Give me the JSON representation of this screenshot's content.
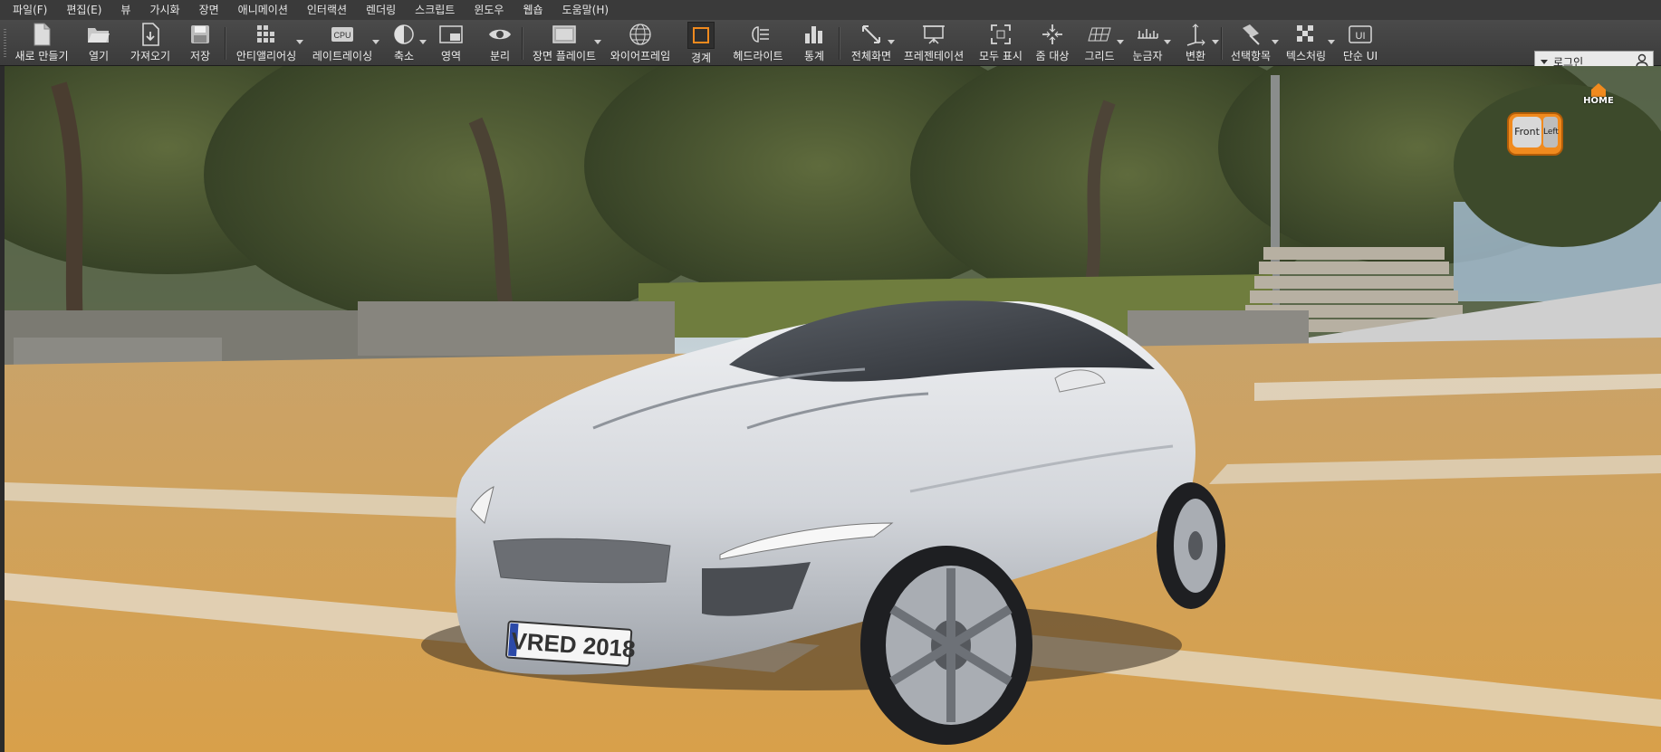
{
  "menu": [
    "파일(F)",
    "편집(E)",
    "뷰",
    "가시화",
    "장면",
    "애니메이션",
    "인터랙션",
    "렌더링",
    "스크립트",
    "윈도우",
    "웹숍",
    "도움말(H)"
  ],
  "toolbar": [
    {
      "label": "새로 만들기",
      "icon": "new-file-icon"
    },
    {
      "label": "열기",
      "icon": "open-folder-icon"
    },
    {
      "label": "가져오기",
      "icon": "import-icon"
    },
    {
      "label": "저장",
      "icon": "save-icon"
    },
    {
      "label": "안티앨리어싱",
      "icon": "antialiasing-icon"
    },
    {
      "label": "레이트레이싱",
      "icon": "cpu-icon"
    },
    {
      "label": "축소",
      "icon": "contrast-icon"
    },
    {
      "label": "영역",
      "icon": "region-icon"
    },
    {
      "label": "분리",
      "icon": "eye-icon"
    },
    {
      "label": "장면 플레이트",
      "icon": "scene-plate-icon"
    },
    {
      "label": "와이어프레임",
      "icon": "wireframe-globe-icon"
    },
    {
      "label": "경계",
      "icon": "bounds-icon"
    },
    {
      "label": "헤드라이트",
      "icon": "headlight-icon"
    },
    {
      "label": "통계",
      "icon": "statistics-icon"
    },
    {
      "label": "전체화면",
      "icon": "fullscreen-icon"
    },
    {
      "label": "프레젠테이션",
      "icon": "presentation-icon"
    },
    {
      "label": "모두 표시",
      "icon": "show-all-icon"
    },
    {
      "label": "줌 대상",
      "icon": "zoom-target-icon"
    },
    {
      "label": "그리드",
      "icon": "grid-icon"
    },
    {
      "label": "눈금자",
      "icon": "ruler-icon"
    },
    {
      "label": "변환",
      "icon": "transform-icon"
    },
    {
      "label": "선택항목",
      "icon": "selection-icon"
    },
    {
      "label": "텍스처링",
      "icon": "texturing-icon"
    },
    {
      "label": "단순 UI",
      "icon": "simple-ui-icon"
    }
  ],
  "cpu_badge": "CPU",
  "ui_badge": "UI",
  "login": {
    "label": "로그인",
    "icon": "user-icon"
  },
  "viewcube": {
    "home_label": "HOME",
    "front_label": "Front",
    "left_label": "Left"
  },
  "license_plate": "VRED 2018",
  "colors": {
    "accent_orange": "#f08a1e",
    "toolbar_bg": "#3b3b3b",
    "menubar_bg": "#3a3a3a"
  }
}
